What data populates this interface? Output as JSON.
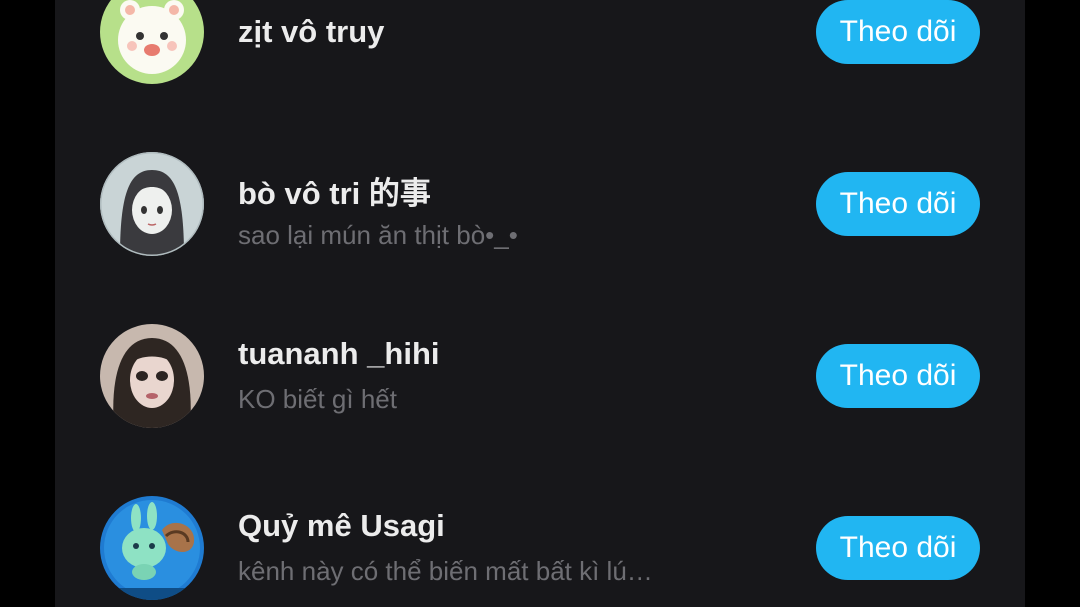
{
  "users": [
    {
      "name": "zịt vô truy",
      "bio": "",
      "follow_label": "Theo dõi",
      "avatar_icon": "cartoon-cat-avatar-icon"
    },
    {
      "name": "bò vô tri 的事",
      "bio": "sao lại mún ăn thịt bò•_•",
      "follow_label": "Theo dõi",
      "avatar_icon": "anime-girl-avatar-icon"
    },
    {
      "name": "tuananh _hihi",
      "bio": "KO biết gì hết",
      "follow_label": "Theo dõi",
      "avatar_icon": "portrait-avatar-icon"
    },
    {
      "name": "Quỷ mê Usagi",
      "bio": "kênh này có thể biến mất bất kì lú…",
      "follow_label": "Theo dõi",
      "avatar_icon": "bunny-avatar-icon"
    }
  ],
  "colors": {
    "background": "#17171a",
    "button": "#21b6f2",
    "name_text": "#ececec",
    "bio_text": "#6e6e73"
  }
}
